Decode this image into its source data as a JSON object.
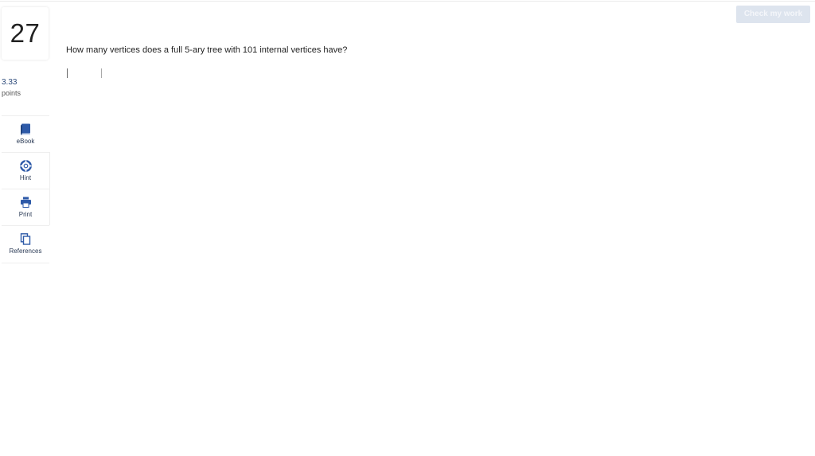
{
  "header": {
    "check_button_label": "Check my work"
  },
  "question": {
    "number": "27",
    "points_value": "3.33",
    "points_label": "points",
    "text": "How many vertices does a full 5-ary tree with 101 internal vertices have?",
    "answer_value": "",
    "answer_placeholder": ""
  },
  "tools": [
    {
      "label": "eBook",
      "icon": "book-icon"
    },
    {
      "label": "Hint",
      "icon": "lifebuoy-icon"
    },
    {
      "label": "Print",
      "icon": "printer-icon"
    },
    {
      "label": "References",
      "icon": "copy-documents-icon"
    }
  ],
  "colors": {
    "icon_blue": "#2e5aa8",
    "button_disabled_bg": "#dde4ee",
    "points_text": "#2c4a7a"
  }
}
